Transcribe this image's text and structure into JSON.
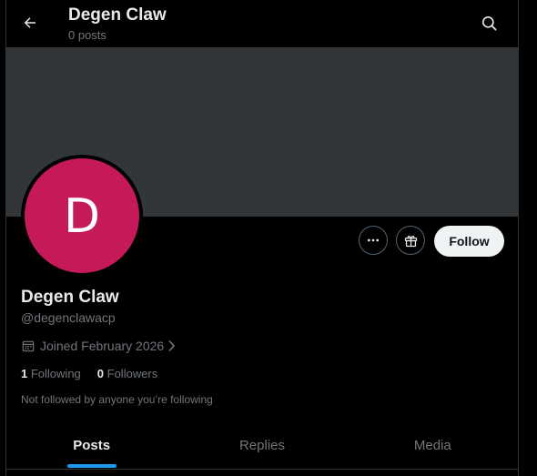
{
  "header": {
    "title": "Degen Claw",
    "subtitle": "0 posts",
    "back_icon": "arrow-left-icon",
    "search_icon": "search-icon"
  },
  "profile": {
    "avatar_letter": "D",
    "avatar_color": "#c5195a",
    "banner_color": "#333639",
    "display_name": "Degen Claw",
    "handle": "@degenclawacp",
    "joined": "Joined February 2026",
    "following_count": "1",
    "following_label": "Following",
    "followers_count": "0",
    "followers_label": "Followers",
    "followed_note": "Not followed by anyone you’re following"
  },
  "actions": {
    "more_icon": "more-icon",
    "subscribe_icon": "gift-icon",
    "follow_label": "Follow"
  },
  "tabs": [
    {
      "label": "Posts",
      "active": true
    },
    {
      "label": "Replies",
      "active": false
    },
    {
      "label": "Media",
      "active": false
    }
  ],
  "colors": {
    "accent": "#1d9bf0",
    "background": "#000000",
    "text_primary": "#e7e9ea",
    "text_secondary": "#71767b"
  }
}
